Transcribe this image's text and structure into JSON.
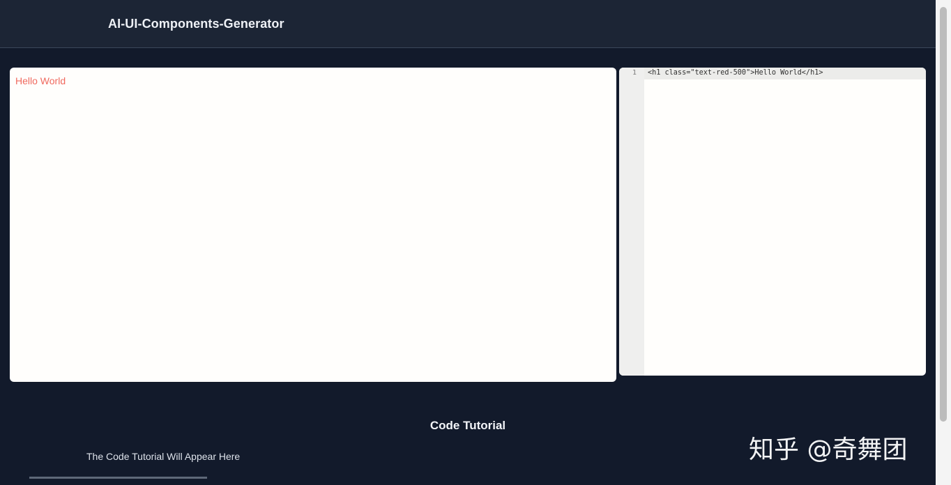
{
  "app": {
    "title": "AI-UI-Components-Generator"
  },
  "preview": {
    "content_text": "Hello World",
    "content_color": "#f0695e"
  },
  "code_editor": {
    "lines": [
      {
        "number": "1",
        "code": "<h1 class=\"text-red-500\">Hello World</h1>"
      }
    ]
  },
  "tutorial": {
    "title": "Code Tutorial",
    "body": "The Code Tutorial Will Appear Here"
  },
  "watermark": {
    "text": "知乎 @奇舞团"
  },
  "colors": {
    "page_background": "#121a2b",
    "header_background": "#1c2535",
    "panel_background": "#fffefc"
  }
}
